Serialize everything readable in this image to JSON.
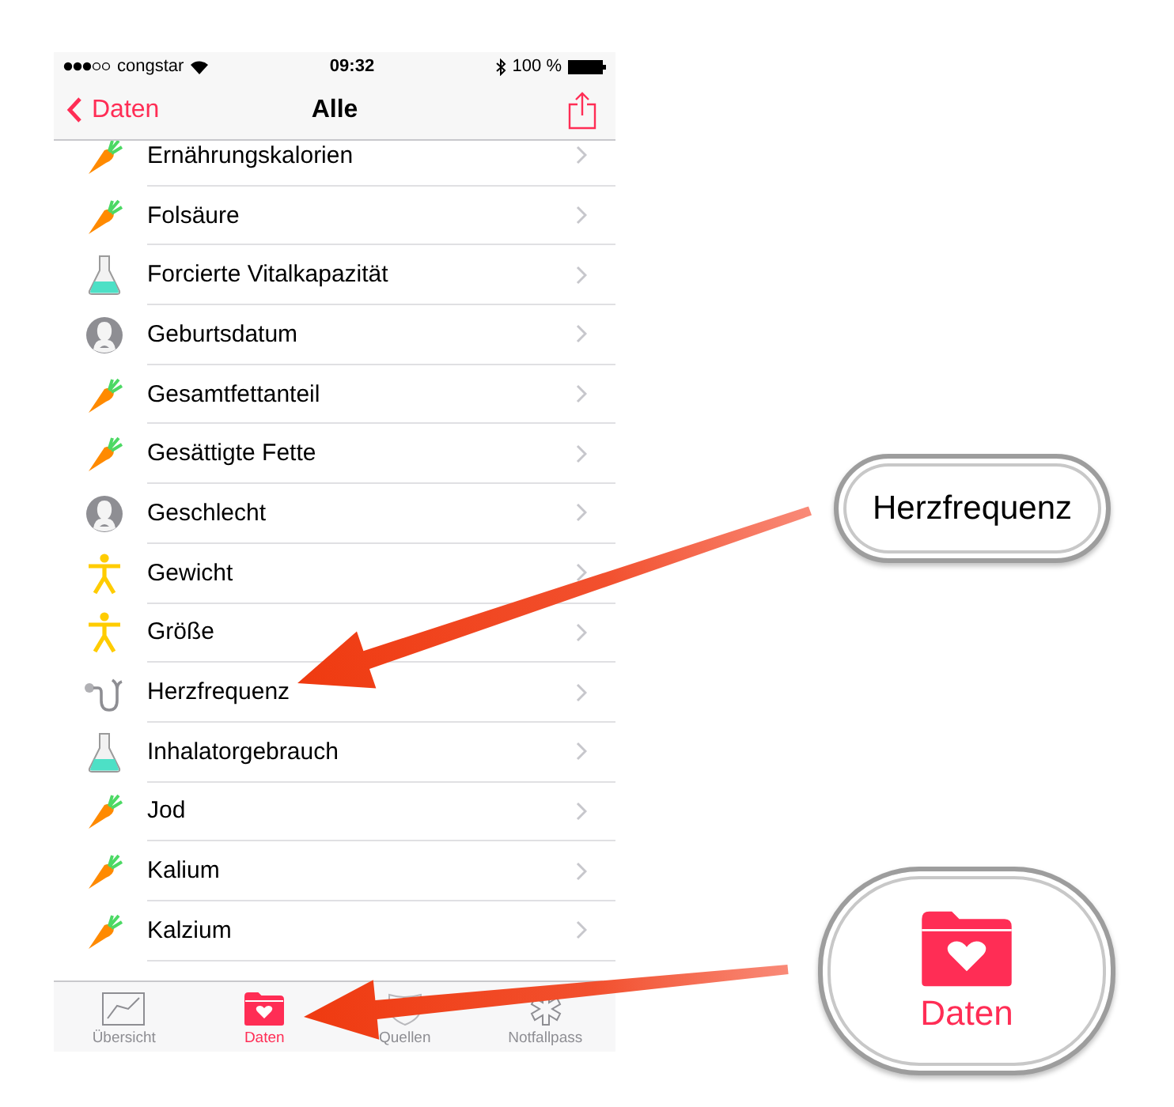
{
  "status_bar": {
    "carrier": "congstar",
    "time": "09:32",
    "battery": "100 %"
  },
  "nav": {
    "back": "Daten",
    "title": "Alle"
  },
  "rows": [
    {
      "label": "Ernährungskalorien",
      "kind": "nutrition"
    },
    {
      "label": "Folsäure",
      "kind": "nutrition"
    },
    {
      "label": "Forcierte Vitalkapazität",
      "kind": "lab"
    },
    {
      "label": "Geburtsdatum",
      "kind": "me"
    },
    {
      "label": "Gesamtfettanteil",
      "kind": "nutrition"
    },
    {
      "label": "Gesättigte Fette",
      "kind": "nutrition"
    },
    {
      "label": "Geschlecht",
      "kind": "me"
    },
    {
      "label": "Gewicht",
      "kind": "body"
    },
    {
      "label": "Größe",
      "kind": "body"
    },
    {
      "label": "Herzfrequenz",
      "kind": "vitals"
    },
    {
      "label": "Inhalatorgebrauch",
      "kind": "lab"
    },
    {
      "label": "Jod",
      "kind": "nutrition"
    },
    {
      "label": "Kalium",
      "kind": "nutrition"
    },
    {
      "label": "Kalzium",
      "kind": "nutrition"
    }
  ],
  "tabs": [
    {
      "label": "Übersicht",
      "kind": "overview",
      "selected": false
    },
    {
      "label": "Daten",
      "kind": "data",
      "selected": true
    },
    {
      "label": "Quellen",
      "kind": "sources",
      "selected": false
    },
    {
      "label": "Notfallpass",
      "kind": "emergency",
      "selected": false
    }
  ],
  "callouts": [
    {
      "label": "Herzfrequenz",
      "kind": "text"
    },
    {
      "label": "Daten",
      "kind": "tab"
    }
  ]
}
